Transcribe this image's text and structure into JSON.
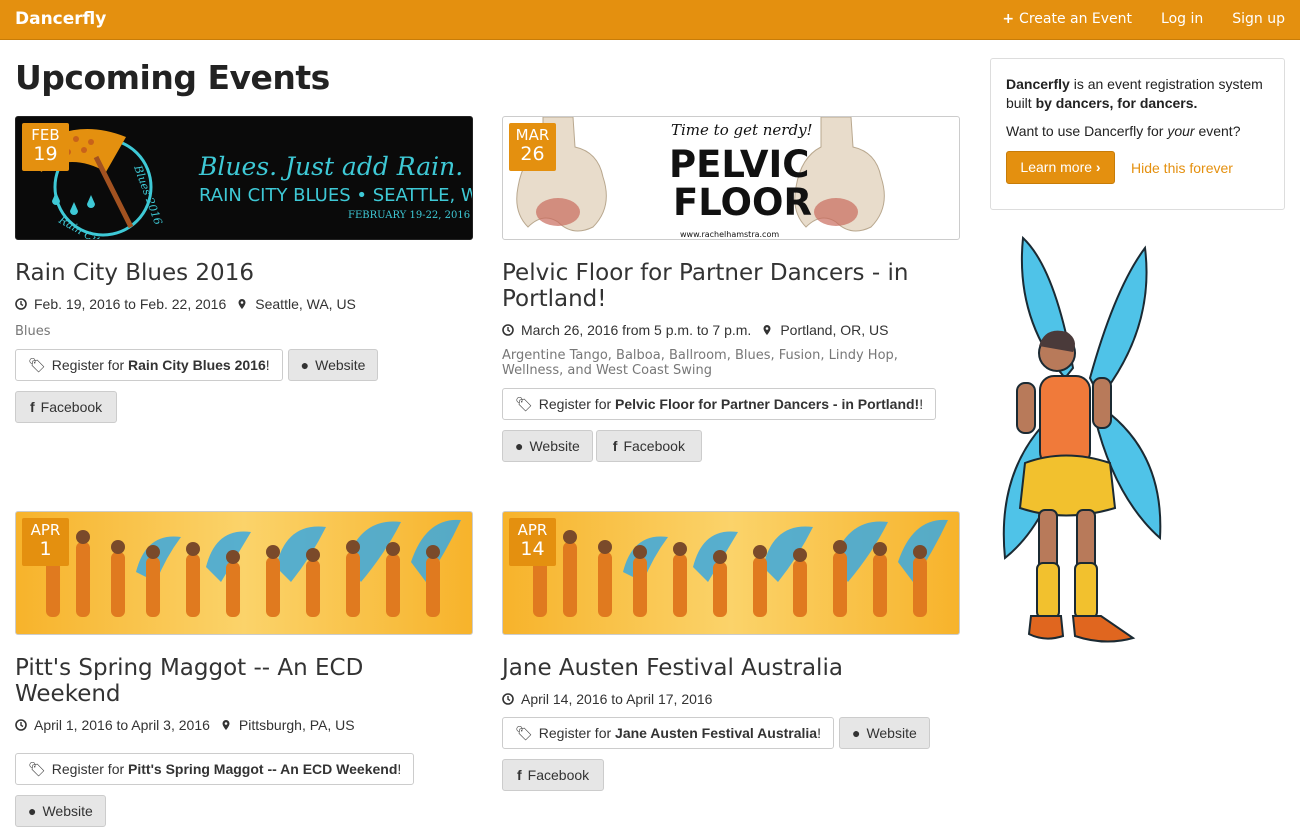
{
  "nav": {
    "brand": "Dancerfly",
    "create_plus": "+",
    "create_label": "Create an Event",
    "login": "Log in",
    "signup": "Sign up"
  },
  "page_title": "Upcoming Events",
  "events": [
    {
      "month": "FEB",
      "day": "19",
      "banner": {
        "line1": "Blues. Just add Rain.",
        "line2": "RAIN CITY BLUES • SEATTLE, WA",
        "line3": "FEBRUARY 19-22, 2016",
        "seal_top": "Blues 2016",
        "seal_bottom": "Rain City"
      },
      "title": "Rain City Blues 2016",
      "dates": "Feb. 19, 2016 to Feb. 22, 2016",
      "location": "Seattle, WA, US",
      "styles": "Blues",
      "register_prefix": "Register for ",
      "register_name": "Rain City Blues 2016",
      "register_suffix": "!",
      "website": "Website",
      "facebook": "Facebook"
    },
    {
      "month": "MAR",
      "day": "26",
      "banner": {
        "tagline": "Time to get nerdy!",
        "line1": "PELVIC",
        "line2": "FLOOR",
        "url": "www.rachelhamstra.com"
      },
      "title": "Pelvic Floor for Partner Dancers - in Portland!",
      "dates": "March 26, 2016 from 5 p.m. to 7 p.m.",
      "location": "Portland, OR, US",
      "styles": "Argentine Tango, Balboa, Ballroom, Blues, Fusion, Lindy Hop, Wellness, and West Coast Swing",
      "register_prefix": "Register for ",
      "register_name": "Pelvic Floor for Partner Dancers - in Portland!",
      "register_suffix": "!",
      "website": "Website",
      "facebook": "Facebook"
    },
    {
      "month": "APR",
      "day": "1",
      "title": "Pitt's Spring Maggot -- An ECD Weekend",
      "dates": "April 1, 2016 to April 3, 2016",
      "location": "Pittsburgh, PA, US",
      "register_prefix": "Register for ",
      "register_name": "Pitt's Spring Maggot -- An ECD Weekend",
      "register_suffix": "!",
      "website": "Website"
    },
    {
      "month": "APR",
      "day": "14",
      "title": "Jane Austen Festival Australia",
      "dates": "April 14, 2016 to April 17, 2016",
      "register_prefix": "Register for ",
      "register_name": "Jane Austen Festival Australia",
      "register_suffix": " !",
      "website": "Website",
      "facebook": "Facebook"
    }
  ],
  "promo": {
    "brand": "Dancerfly",
    "text1": " is an event registration system built ",
    "text1_bold": "by dancers, for dancers.",
    "text2_prefix": "Want to use Dancerfly for ",
    "text2_em": "your",
    "text2_suffix": " event?",
    "learn_more": "Learn more",
    "learn_more_chevron": "›",
    "hide": "Hide this forever"
  },
  "colors": {
    "brand": "#e4900f",
    "wing": "#4fc3e8",
    "banner_dark": "#0a0a0a",
    "banner_teal": "#3ec9d6"
  }
}
